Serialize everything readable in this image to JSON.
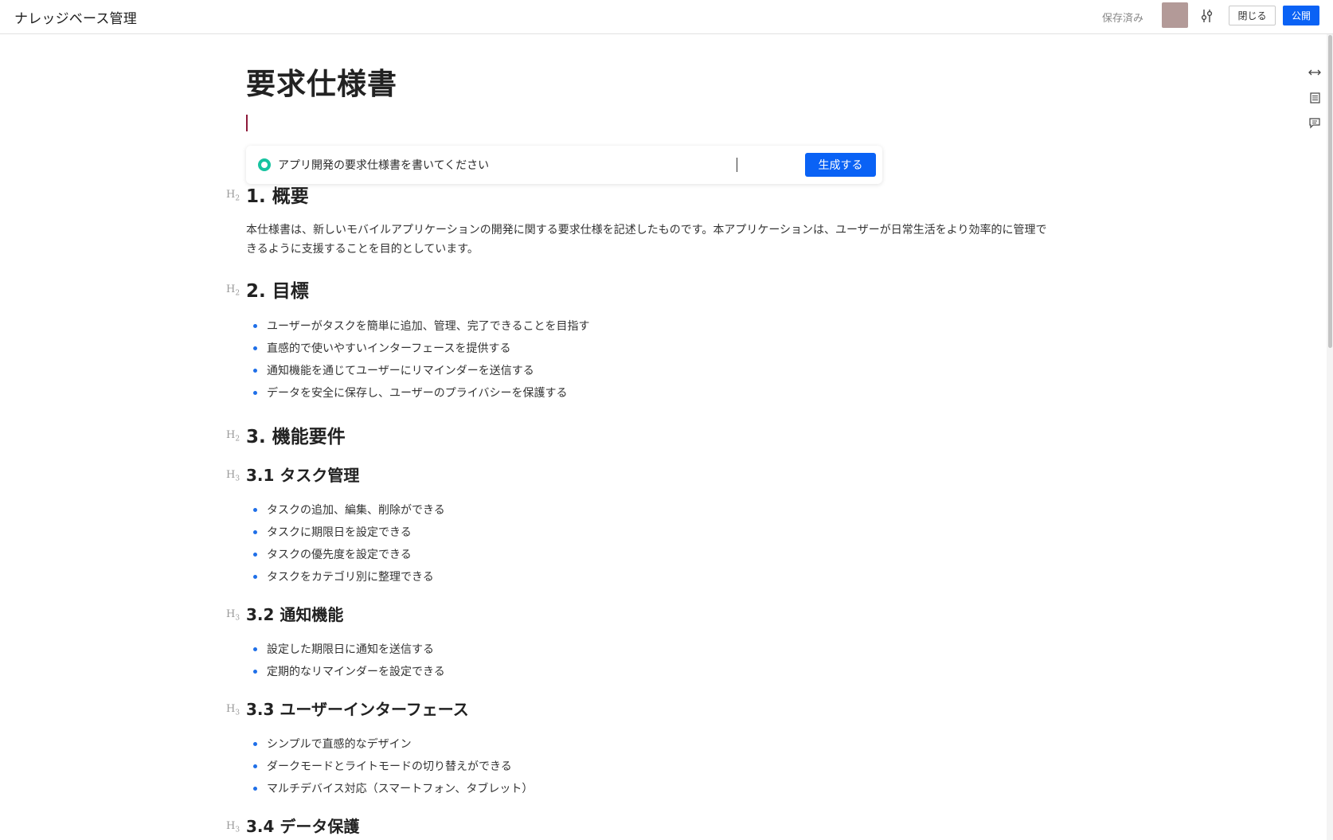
{
  "header": {
    "app_title": "ナレッジベース管理",
    "saved_status": "保存済み",
    "close_label": "閉じる",
    "publish_label": "公開"
  },
  "document": {
    "title": "要求仕様書",
    "ai_prompt": {
      "value": "アプリ開発の要求仕様書を書いてください",
      "generate_label": "生成する"
    },
    "sections": {
      "overview": {
        "heading": "1. 概要",
        "paragraph": "本仕様書は、新しいモバイルアプリケーションの開発に関する要求仕様を記述したものです。本アプリケーションは、ユーザーが日常生活をより効率的に管理できるように支援することを目的としています。"
      },
      "goals": {
        "heading": "2. 目標",
        "items": [
          "ユーザーがタスクを簡単に追加、管理、完了できることを目指す",
          "直感的で使いやすいインターフェースを提供する",
          "通知機能を通じてユーザーにリマインダーを送信する",
          "データを安全に保存し、ユーザーのプライバシーを保護する"
        ]
      },
      "functional": {
        "heading": "3. 機能要件",
        "task": {
          "heading": "3.1 タスク管理",
          "items": [
            "タスクの追加、編集、削除ができる",
            "タスクに期限日を設定できる",
            "タスクの優先度を設定できる",
            "タスクをカテゴリ別に整理できる"
          ]
        },
        "notify": {
          "heading": "3.2 通知機能",
          "items": [
            "設定した期限日に通知を送信する",
            "定期的なリマインダーを設定できる"
          ]
        },
        "ui": {
          "heading": "3.3 ユーザーインターフェース",
          "items": [
            "シンプルで直感的なデザイン",
            "ダークモードとライトモードの切り替えができる",
            "マルチデバイス対応（スマートフォン、タブレット）"
          ]
        },
        "data": {
          "heading": "3.4 データ保護"
        }
      }
    }
  },
  "heading_marks": {
    "h2": "H",
    "h2_level": "2",
    "h3": "H",
    "h3_level": "3"
  },
  "icons": {
    "settings": "sliders-icon",
    "expand_width": "expand-width-icon",
    "outline": "outline-icon",
    "comment": "comment-icon",
    "ai": "ai-circle-icon"
  },
  "colors": {
    "accent": "#0a62f5",
    "ai_icon": "#17c3a0",
    "bullet": "#1f6fe8",
    "avatar": "#b39a98",
    "caret": "#8e1a3a"
  }
}
